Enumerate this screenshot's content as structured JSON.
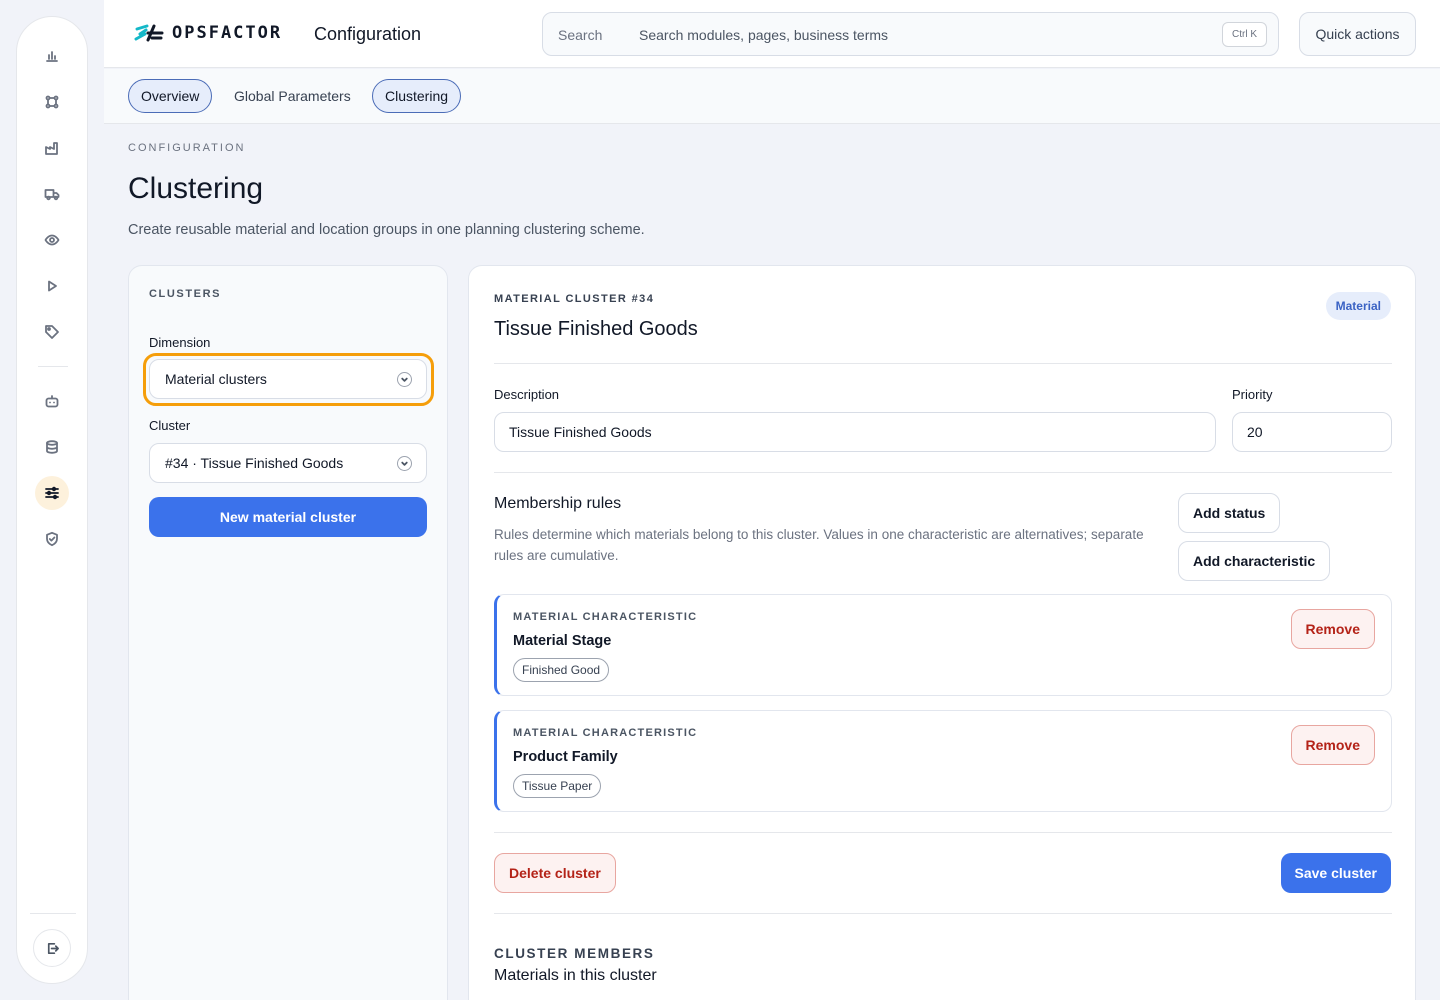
{
  "brand": {
    "name": "OPSFACTOR",
    "accent": "#3b72eb",
    "focus": "#f59e0b"
  },
  "header": {
    "app_title": "Configuration",
    "search_label": "Search",
    "search_placeholder": "Search modules, pages, business terms",
    "search_shortcut": "Ctrl K",
    "quick_actions": "Quick actions"
  },
  "rail": {
    "items": [
      {
        "icon": "bar-chart-icon"
      },
      {
        "icon": "network-icon"
      },
      {
        "icon": "factory-icon"
      },
      {
        "icon": "truck-icon"
      },
      {
        "icon": "eye-icon"
      },
      {
        "icon": "play-icon"
      },
      {
        "icon": "tag-icon"
      },
      {
        "icon": "robot-icon"
      },
      {
        "icon": "database-icon"
      },
      {
        "icon": "sliders-icon",
        "active": true
      },
      {
        "icon": "shield-check-icon"
      }
    ],
    "logout_icon": "logout-icon"
  },
  "tabs": [
    {
      "label": "Overview"
    },
    {
      "label": "Global Parameters"
    },
    {
      "label": "Clustering"
    }
  ],
  "page": {
    "eyebrow": "CONFIGURATION",
    "title": "Clustering",
    "subtitle": "Create reusable material and location groups in one planning clustering scheme."
  },
  "clusters_panel": {
    "heading": "CLUSTERS",
    "dimension_label": "Dimension",
    "dimension_value": "Material clusters",
    "cluster_label": "Cluster",
    "cluster_value": "#34 · Tissue Finished Goods",
    "new_button": "New material cluster"
  },
  "detail": {
    "eyebrow": "MATERIAL CLUSTER #34",
    "title": "Tissue Finished Goods",
    "badge": "Material",
    "description_label": "Description",
    "description_value": "Tissue Finished Goods",
    "priority_label": "Priority",
    "priority_value": "20",
    "rules_title": "Membership rules",
    "rules_desc": "Rules determine which materials belong to this cluster. Values in one characteristic are alternatives; separate rules are cumulative.",
    "add_status": "Add status",
    "add_characteristic": "Add characteristic",
    "rules": [
      {
        "type": "MATERIAL CHARACTERISTIC",
        "name": "Material Stage",
        "value": "Finished Good",
        "remove": "Remove"
      },
      {
        "type": "MATERIAL CHARACTERISTIC",
        "name": "Product Family",
        "value": "Tissue Paper",
        "remove": "Remove"
      }
    ],
    "delete_button": "Delete cluster",
    "save_button": "Save cluster",
    "members_eyebrow": "CLUSTER MEMBERS",
    "members_sub": "Materials in this cluster"
  }
}
